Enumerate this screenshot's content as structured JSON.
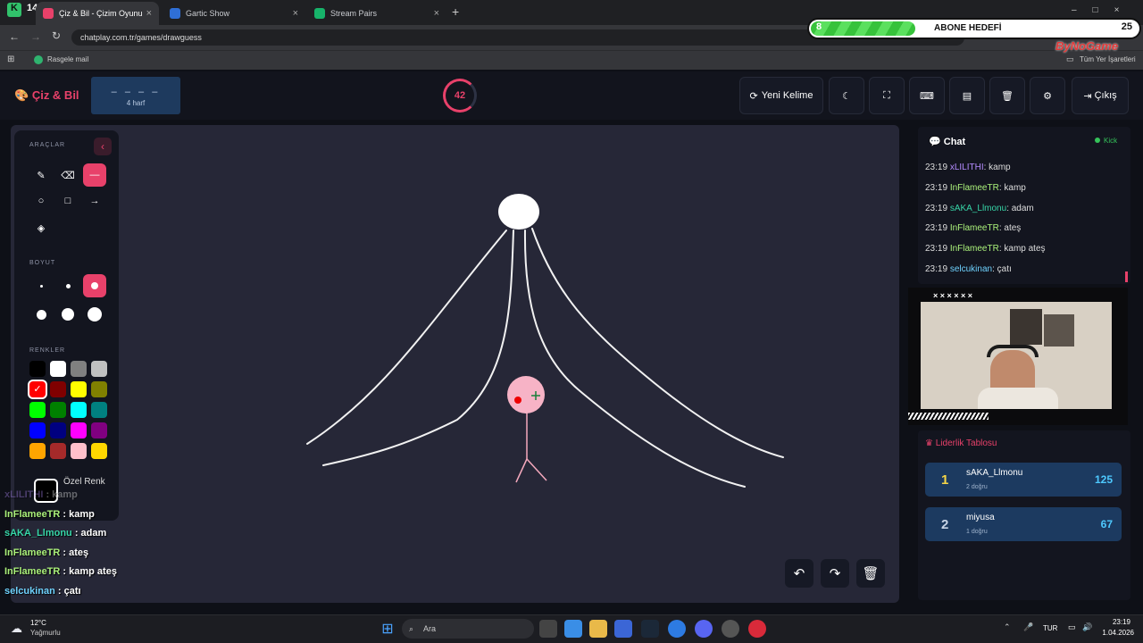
{
  "browser": {
    "tabs": [
      {
        "title": "Çiz & Bil - Çizim Oyunu"
      },
      {
        "title": "Gartic Show"
      },
      {
        "title": "Stream Pairs"
      }
    ],
    "url": "chatplay.com.tr/games/drawguess",
    "bookmark": "Rasgele mail",
    "all_bookmarks": "Tüm Yer İşaretleri",
    "badge": "14"
  },
  "sub_goal": {
    "current": "8",
    "label": "ABONE HEDEFİ",
    "target": "25",
    "progress": 0.32,
    "watermark": "ByNoGame"
  },
  "app": {
    "logo": "Çiz & Bil",
    "word_mask": "– – – –",
    "word_hint": "4 harf",
    "timer": "42",
    "new_word": "Yeni Kelime",
    "exit": "Çıkış"
  },
  "tools": {
    "title": "ARAÇLAR",
    "size_title": "BOYUT",
    "colors_title": "RENKLER",
    "custom_color": "Özel Renk",
    "palette": [
      "#000000",
      "#ffffff",
      "#808080",
      "#c0c0c0",
      "#ff0000",
      "#800000",
      "#ffff00",
      "#808000",
      "#00ff00",
      "#008000",
      "#00ffff",
      "#008080",
      "#0000ff",
      "#000080",
      "#ff00ff",
      "#800080",
      "#ffa500",
      "#a52a2a",
      "#ffc0cb",
      "#ffd700"
    ]
  },
  "chat": {
    "title": "Chat",
    "source": "Kick",
    "messages": [
      {
        "time": "23:19",
        "user": "xLILITHI",
        "text": ": kamp",
        "color": "#b48cff"
      },
      {
        "time": "23:19",
        "user": "InFlameeTR",
        "text": ": kamp",
        "color": "#aaf07a"
      },
      {
        "time": "23:19",
        "user": "sAKA_Llmonu",
        "text": ": adam",
        "color": "#37d6a8"
      },
      {
        "time": "23:19",
        "user": "InFlameeTR",
        "text": ": ateş",
        "color": "#aaf07a"
      },
      {
        "time": "23:19",
        "user": "InFlameeTR",
        "text": ": kamp ateş",
        "color": "#aaf07a"
      },
      {
        "time": "23:19",
        "user": "selcukinan",
        "text": ": çatı",
        "color": "#6fd3ff"
      }
    ]
  },
  "overlay_chat": [
    {
      "user": "xLILITHI",
      "text": ": kamp",
      "color": "#b48cff"
    },
    {
      "user": "InFlameeTR",
      "text": ": kamp",
      "color": "#aaf07a"
    },
    {
      "user": "sAKA_Llmonu",
      "text": ": adam",
      "color": "#37d6a8"
    },
    {
      "user": "InFlameeTR",
      "text": ": ateş",
      "color": "#aaf07a"
    },
    {
      "user": "InFlameeTR",
      "text": ": kamp ateş",
      "color": "#aaf07a"
    },
    {
      "user": "selcukinan",
      "text": ": çatı",
      "color": "#6fd3ff"
    }
  ],
  "cam_label": "× × × × × ×",
  "leaderboard": {
    "title": "Liderlik Tablosu",
    "rows": [
      {
        "rank": "1",
        "name": "sAKA_Llmonu",
        "sub": "2 doğru",
        "score": "125"
      },
      {
        "rank": "2",
        "name": "miyusa",
        "sub": "1 doğru",
        "score": "67"
      }
    ]
  },
  "taskbar": {
    "temp": "12°C",
    "weather": "Yağmurlu",
    "search": "Ara",
    "lang": "TUR",
    "time": "23:19",
    "date": "1.04.2026"
  }
}
